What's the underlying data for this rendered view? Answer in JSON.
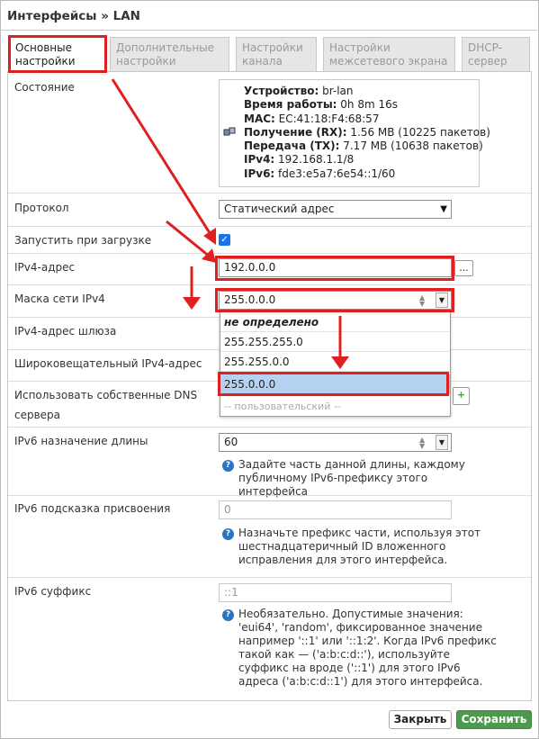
{
  "title": "Интерфейсы » LAN",
  "tabs": [
    {
      "line1": "Основные",
      "line2": "настройки",
      "active": true
    },
    {
      "line1": "Дополнительные",
      "line2": "настройки",
      "active": false
    },
    {
      "line1": "Настройки",
      "line2": "канала",
      "active": false
    },
    {
      "line1": "Настройки",
      "line2": "межсетевого экрана",
      "active": false
    },
    {
      "line1": "DHCP-",
      "line2": "сервер",
      "active": false
    }
  ],
  "status": {
    "label": "Состояние",
    "lines": [
      {
        "key": "Устройство:",
        "value": " br-lan"
      },
      {
        "key": "Время работы:",
        "value": " 0h 8m 16s"
      },
      {
        "key": "MAC:",
        "value": " EC:41:18:F4:68:57"
      },
      {
        "key": "Получение (RX):",
        "value": " 1.56 MB (10225 пакетов)"
      },
      {
        "key": "Передача (TX):",
        "value": " 7.17 MB (10638 пакетов)"
      },
      {
        "key": "IPv4:",
        "value": " 192.168.1.1/8"
      },
      {
        "key": "IPv6:",
        "value": " fde3:e5a7:6e54::1/60"
      }
    ]
  },
  "protocol": {
    "label": "Протокол",
    "value": "Статический адрес"
  },
  "autostart": {
    "label": "Запустить при загрузке",
    "checked": true
  },
  "ipv4": {
    "label": "IPv4-адрес",
    "value": "192.0.0.0",
    "extra_button": "..."
  },
  "netmask": {
    "label": "Маска сети IPv4",
    "value": "255.0.0.0",
    "options": [
      "не определено",
      "255.255.255.0",
      "255.255.0.0",
      "255.0.0.0",
      "-- пользовательский --"
    ]
  },
  "gateway": {
    "label": "IPv4-адрес шлюза"
  },
  "broadcast": {
    "label": "Широковещательный IPv4-адрес"
  },
  "dns": {
    "label_line1": "Использовать собственные DNS",
    "label_line2": "сервера",
    "add_button": "+"
  },
  "ipv6_assign": {
    "label": "IPv6 назначение длины",
    "value": "60",
    "help": "Задайте часть данной длины, каждому публичному IPv6-префиксу этого интерфейса"
  },
  "ipv6_hint": {
    "label": "IPv6 подсказка присвоения",
    "placeholder": "0",
    "help": "Назначьте префикс части, используя этот шестнадцатеричный ID вложенного исправления для этого интерфейса."
  },
  "ipv6_suffix": {
    "label": "IPv6 суффикс",
    "placeholder": "::1",
    "help": "Необязательно. Допустимые значения: 'eui64', 'random', фиксированное значение например '::1' или '::1:2'. Когда IPv6 префикс такой как — ('a:b:c:d::'), используйте суффикс на вроде ('::1') для этого IPv6 адреса ('a:b:c:d::1') для этого интерфейса."
  },
  "buttons": {
    "close": "Закрыть",
    "save": "Сохранить"
  },
  "colors": {
    "accent_red": "#e02020",
    "save_green": "#4c9a4c",
    "selected_option": "#b5d1f2"
  }
}
